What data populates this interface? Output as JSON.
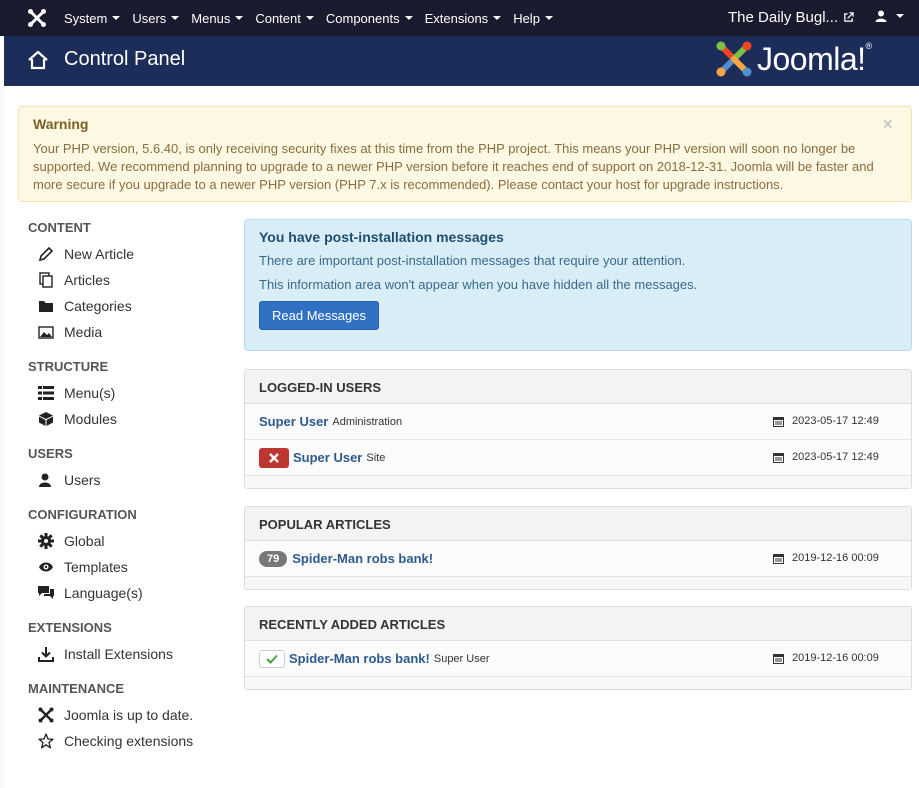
{
  "topnav": {
    "menu": [
      {
        "label": "System"
      },
      {
        "label": "Users"
      },
      {
        "label": "Menus"
      },
      {
        "label": "Content"
      },
      {
        "label": "Components"
      },
      {
        "label": "Extensions"
      },
      {
        "label": "Help"
      }
    ],
    "site_name": "The Daily Bugl..."
  },
  "header": {
    "title": "Control Panel",
    "brand": "Joomla!",
    "brand_word": "Joomla",
    "brand_suffix": "!",
    "brand_reg": "®"
  },
  "warning": {
    "title": "Warning",
    "text": "Your PHP version, 5.6.40, is only receiving security fixes at this time from the PHP project. This means your PHP version will soon no longer be supported. We recommend planning to upgrade to a newer PHP version before it reaches end of support on 2018-12-31. Joomla will be faster and more secure if you upgrade to a newer PHP version (PHP 7.x is recommended). Please contact your host for upgrade instructions.",
    "close": "×"
  },
  "sidebar": {
    "sections": [
      {
        "title": "CONTENT",
        "items": [
          {
            "label": "New Article",
            "icon": "pencil-icon"
          },
          {
            "label": "Articles",
            "icon": "copy-icon"
          },
          {
            "label": "Categories",
            "icon": "folder-icon"
          },
          {
            "label": "Media",
            "icon": "image-icon"
          }
        ]
      },
      {
        "title": "STRUCTURE",
        "items": [
          {
            "label": "Menu(s)",
            "icon": "list-icon"
          },
          {
            "label": "Modules",
            "icon": "cube-icon"
          }
        ]
      },
      {
        "title": "USERS",
        "items": [
          {
            "label": "Users",
            "icon": "user-icon"
          }
        ]
      },
      {
        "title": "CONFIGURATION",
        "items": [
          {
            "label": "Global",
            "icon": "gear-icon"
          },
          {
            "label": "Templates",
            "icon": "eye-icon"
          },
          {
            "label": "Language(s)",
            "icon": "comments-icon"
          }
        ]
      },
      {
        "title": "EXTENSIONS",
        "items": [
          {
            "label": "Install Extensions",
            "icon": "download-icon"
          }
        ]
      },
      {
        "title": "MAINTENANCE",
        "items": [
          {
            "label": "Joomla is up to date.",
            "icon": "joomla-icon"
          },
          {
            "label": "Checking extensions",
            "icon": "star-icon"
          }
        ]
      }
    ]
  },
  "postinstall": {
    "title": "You have post-installation messages",
    "line1": "There are important post-installation messages that require your attention.",
    "line2": "This information area won't appear when you have hidden all the messages.",
    "button": "Read Messages"
  },
  "logged_in": {
    "title": "LOGGED-IN USERS",
    "rows": [
      {
        "name": "Super User",
        "where": "Administration",
        "date": "2023-05-17 12:49"
      },
      {
        "name": "Super User",
        "where": "Site",
        "date": "2023-05-17 12:49"
      }
    ]
  },
  "popular": {
    "title": "POPULAR ARTICLES",
    "rows": [
      {
        "hits": "79",
        "title": "Spider-Man robs bank!",
        "date": "2019-12-16 00:09"
      }
    ]
  },
  "recent": {
    "title": "RECENTLY ADDED ARTICLES",
    "rows": [
      {
        "title": "Spider-Man robs bank!",
        "author": "Super User",
        "date": "2019-12-16 00:09"
      }
    ]
  },
  "colors": {
    "topnav_bg": "#1a1b2e",
    "header_bg": "#1c2d5a",
    "warning_bg": "#fcf8e3",
    "info_bg": "#d9edf7",
    "primary_button": "#3071c4",
    "danger": "#bd362f",
    "success": "#46a546"
  }
}
